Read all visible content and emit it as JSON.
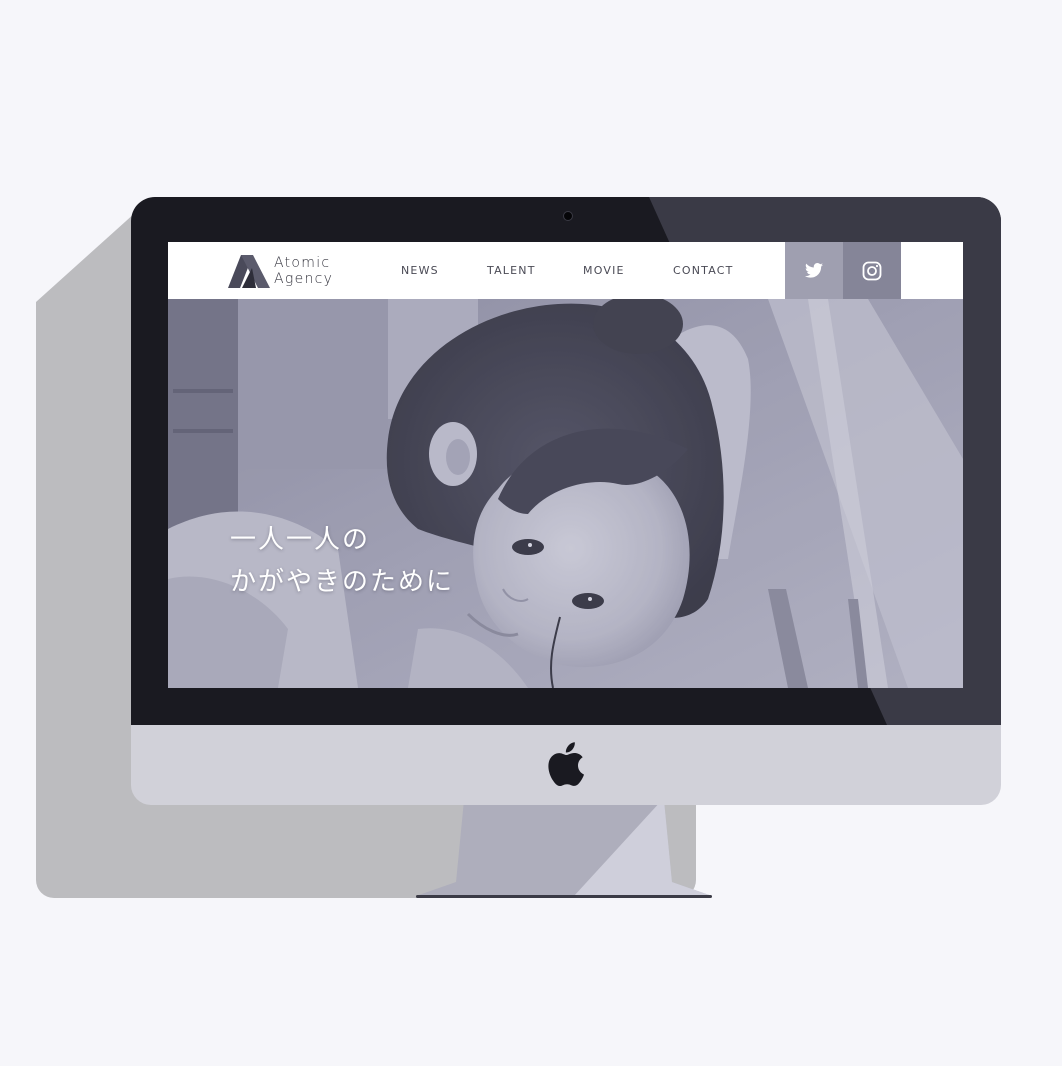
{
  "brand": {
    "name_line1": "Atomic",
    "name_line2": "Agency"
  },
  "nav": {
    "items": [
      {
        "label": "NEWS"
      },
      {
        "label": "TALENT"
      },
      {
        "label": "MOVIE"
      },
      {
        "label": "CONTACT"
      }
    ]
  },
  "social": {
    "twitter_icon": "twitter-bird-icon",
    "instagram_icon": "instagram-camera-icon"
  },
  "hero": {
    "line1": "一人一人の",
    "line2": "かがやきのために"
  },
  "device": {
    "logo_icon": "apple-logo-icon"
  },
  "colors": {
    "page_background": "#f6f6fa",
    "bezel": "#1a1a21",
    "chin": "#d1d1d9",
    "twitter_button": "#9f9fb0",
    "instagram_button": "#858598",
    "hero_tint": "#9d9db0"
  }
}
